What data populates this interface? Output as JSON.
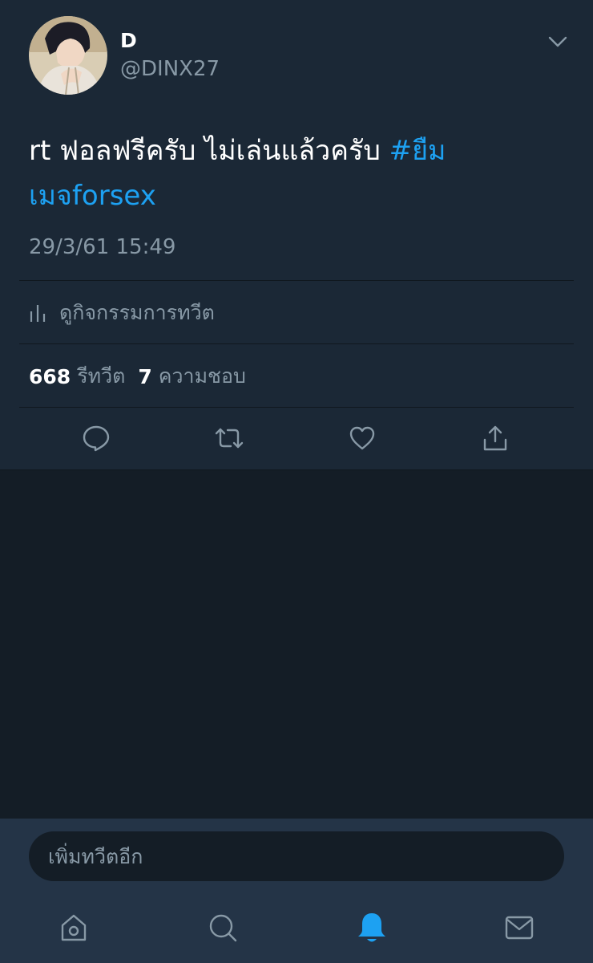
{
  "tweet": {
    "display_name": "D",
    "handle": "@DINX27",
    "text_plain": "rt ฟอลฟรีครับ ไม่เล่นแล้วครับ ",
    "hashtag": "#ยืมเมจforsex",
    "timestamp": "29/3/61 15:49",
    "activity_label": "ดูกิจกรรมการทวีต",
    "retweet_count": "668",
    "retweet_label": "รีทวีต",
    "like_count": "7",
    "like_label": "ความชอบ"
  },
  "actions": {
    "icons": [
      "reply-icon",
      "retweet-icon",
      "like-icon",
      "share-icon"
    ]
  },
  "composer": {
    "placeholder": "เพิ่มทวีตอีก"
  },
  "bottom_nav": {
    "icons": [
      "home-icon",
      "search-icon",
      "notifications-icon",
      "messages-icon"
    ],
    "active": "notifications-icon"
  },
  "colors": {
    "card_bg": "#1b2836",
    "page_bg": "#141d26",
    "nav_bg": "#243447",
    "accent": "#1da1f2",
    "secondary_text": "#8899a6"
  }
}
